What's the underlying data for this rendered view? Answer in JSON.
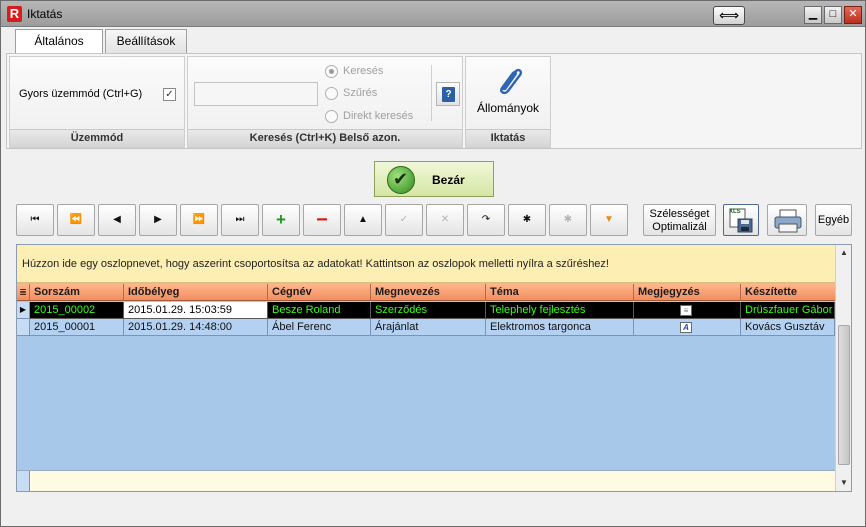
{
  "window": {
    "title": "Iktatás",
    "app_icon": "R"
  },
  "tabs": [
    {
      "label": "Általános",
      "active": true
    },
    {
      "label": "Beállítások",
      "active": false
    }
  ],
  "ribbon": {
    "mode_group": {
      "label": "Üzemmód",
      "quick_mode_label": "Gyors üzemmód (Ctrl+G)",
      "quick_mode_checked": true
    },
    "search_group": {
      "label": "Keresés (Ctrl+K) Belső azon.",
      "input_value": "",
      "options": [
        {
          "label": "Keresés",
          "checked": true
        },
        {
          "label": "Szűrés",
          "checked": false
        },
        {
          "label": "Direkt keresés",
          "checked": false
        }
      ]
    },
    "filing_group": {
      "label": "Iktatás",
      "attachments_label": "Állományok"
    }
  },
  "close_button": {
    "label": "Bezár"
  },
  "nav_buttons": [
    {
      "name": "first-record-button",
      "glyph": "⏮"
    },
    {
      "name": "prev-page-button",
      "glyph": "⏪"
    },
    {
      "name": "prev-record-button",
      "glyph": "◀"
    },
    {
      "name": "next-record-button",
      "glyph": "▶"
    },
    {
      "name": "next-page-button",
      "glyph": "⏩"
    },
    {
      "name": "last-record-button",
      "glyph": "⏭"
    },
    {
      "name": "add-record-button",
      "glyph": "+"
    },
    {
      "name": "delete-record-button",
      "glyph": "−"
    },
    {
      "name": "edit-record-button",
      "glyph": "▲"
    },
    {
      "name": "post-record-button",
      "glyph": "✓"
    },
    {
      "name": "cancel-edit-button",
      "glyph": "✕"
    },
    {
      "name": "refresh-button",
      "glyph": "↷"
    },
    {
      "name": "bookmark-button",
      "glyph": "✱"
    },
    {
      "name": "goto-bookmark-button",
      "glyph": "✱"
    },
    {
      "name": "filter-button",
      "glyph": "▼"
    }
  ],
  "side_buttons": {
    "optimize_width": "Szélességet Optimalizál",
    "export_xls_icon": "xls-save-icon",
    "export_xls_text": "XLS",
    "print_icon": "printer-icon",
    "other": "Egyéb"
  },
  "grid": {
    "group_hint": "Húzzon ide egy oszlopnevet, hogy aszerint csoportosítsa az adatokat! Kattintson az oszlopok melletti nyílra a szűréshez!",
    "columns": [
      "Sorszám",
      "Időbélyeg",
      "Cégnév",
      "Megnevezés",
      "Téma",
      "Megjegyzés",
      "Készítette"
    ],
    "rows": [
      {
        "sorszam": "2015_00002",
        "idobelyeg": "2015.01.29. 15:03:59",
        "cegnev": "Besze Roland",
        "megnevezes": "Szerződés",
        "tema": "Telephely fejlesztés",
        "megjegyzes_icon": "note-icon",
        "keszitette": "Drüszfauer Gábor",
        "selected": true
      },
      {
        "sorszam": "2015_00001",
        "idobelyeg": "2015.01.29. 14:48:00",
        "cegnev": "Ábel Ferenc",
        "megnevezes": "Árajánlat",
        "tema": "Elektromos targonca",
        "megjegyzes_icon": "text-note-icon",
        "megjegyzes_glyph": "A",
        "keszitette": "Kovács Gusztáv",
        "selected": false
      }
    ]
  },
  "colors": {
    "header_orange": "#f28d5e",
    "selected_text": "#3cff18",
    "grid_bg": "#a8c8ea",
    "group_panel": "#fdefb3"
  }
}
